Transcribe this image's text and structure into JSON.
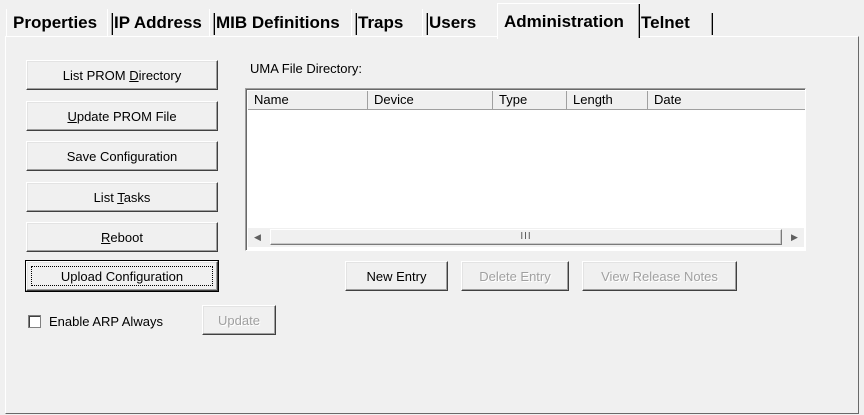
{
  "tabs": [
    {
      "label": "Properties"
    },
    {
      "label": "IP Address"
    },
    {
      "label": "MIB Definitions"
    },
    {
      "label": "Traps"
    },
    {
      "label": "Users"
    },
    {
      "label": "Administration",
      "active": true
    },
    {
      "label": "Telnet"
    }
  ],
  "buttons": {
    "list_prom_pre": "List PROM ",
    "list_prom_u": "D",
    "list_prom_post": "irectory",
    "update_prom_u": "U",
    "update_prom_post": "pdate PROM File",
    "save_config": "Save Configuration",
    "list_tasks_pre": "List ",
    "list_tasks_u": "T",
    "list_tasks_post": "asks",
    "reboot_u": "R",
    "reboot_post": "eboot",
    "upload_config": "Upload Configuration",
    "new_entry": "New Entry",
    "delete_entry": "Delete Entry",
    "view_release_notes": "View Release Notes",
    "update": "Update"
  },
  "directory": {
    "label": "UMA File Directory:",
    "columns": [
      "Name",
      "Device",
      "Type",
      "Length",
      "Date"
    ],
    "scroll_thumb": "III"
  },
  "arp": {
    "label": "Enable ARP Always",
    "checked": false
  }
}
